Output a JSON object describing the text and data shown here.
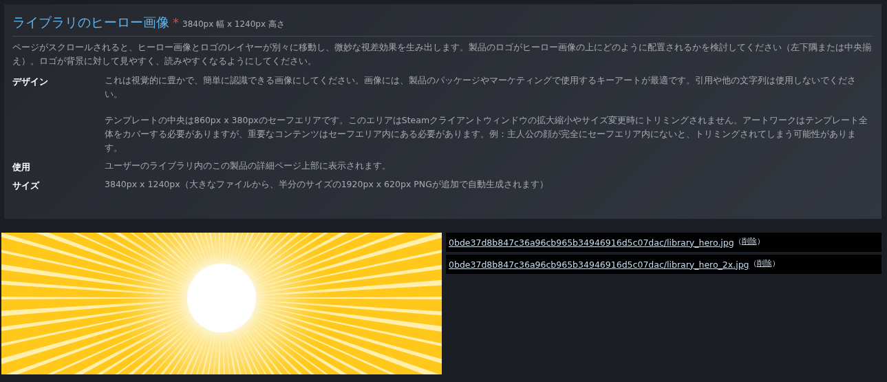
{
  "section": {
    "title": "ライブラリのヒーロー画像",
    "required_mark": "*",
    "dimensions": "3840px 幅 x 1240px 高さ",
    "intro": "ページがスクロールされると、ヒーロー画像とロゴのレイヤーが別々に移動し、微妙な視差効果を生み出します。製品のロゴがヒーロー画像の上にどのように配置されるかを検討してください（左下隅または中央揃え）。ロゴが背景に対して見やすく、読みやすくなるようにしてください。",
    "details": [
      {
        "label": "デザイン",
        "paragraphs": [
          "これは視覚的に豊かで、簡単に認識できる画像にしてください。画像には、製品のパッケージやマーケティングで使用するキーアートが最適です。引用や他の文字列は使用しないでください。",
          "テンプレートの中央は860px x 380pxのセーフエリアです。このエリアはSteamクライアントウィンドウの拡大縮小やサイズ変更時にトリミングされません。アートワークはテンプレート全体をカバーする必要がありますが、重要なコンテンツはセーフエリア内にある必要があります。例：主人公の顔が完全にセーフエリア内にないと、トリミングされてしまう可能性があります。"
        ]
      },
      {
        "label": "使用",
        "paragraphs": [
          "ユーザーのライブラリ内のこの製品の詳細ページ上部に表示されます。"
        ]
      },
      {
        "label": "サイズ",
        "paragraphs": [
          "3840px x 1240px（大きなファイルから、半分のサイズの1920px x 620px PNGが追加で自動生成されます）"
        ]
      }
    ]
  },
  "upload": {
    "files": [
      {
        "name": "0bde37d8b847c36a96cb965b34946916d5c07dac/library_hero.jpg",
        "open": "（",
        "delete": "削除",
        "close": "）"
      },
      {
        "name": "0bde37d8b847c36a96cb965b34946916d5c07dac/library_hero_2x.jpg",
        "open": "（",
        "delete": "削除",
        "close": "）"
      }
    ]
  }
}
